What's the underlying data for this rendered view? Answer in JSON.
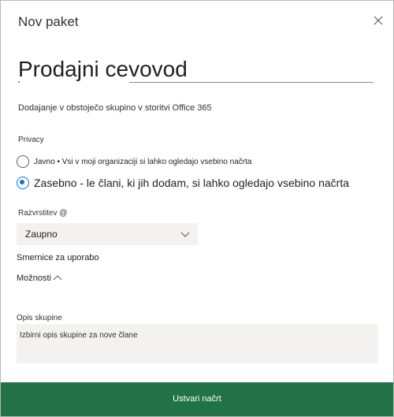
{
  "dialog": {
    "title": "Nov paket",
    "close_icon": "close-icon"
  },
  "name_field": {
    "value": "Prodajni cevovod"
  },
  "subtitle": "Dodajanje v obstoječo skupino v storitvi Office 365",
  "privacy": {
    "label": "Privacy",
    "options": [
      {
        "label": "Javno • Vsi v moji organizaciji si lahko ogledajo vsebino načrta",
        "selected": false
      },
      {
        "label": "Zasebno - le člani, ki jih dodam, si lahko ogledajo vsebino načrta",
        "selected": true
      }
    ]
  },
  "classification": {
    "label": "Razvrstitev @",
    "value": "Zaupno",
    "chevron_icon": "chevron-down-icon"
  },
  "usage_guidelines": "Smernice za uporabo",
  "options_toggle": {
    "label": "Možnosti",
    "chevron_icon": "chevron-up-icon"
  },
  "description": {
    "label": "Opis skupine",
    "placeholder": "Izbirni opis skupine za nove člane"
  },
  "footer": {
    "create_label": "Ustvari načrt"
  },
  "colors": {
    "accent": "#0078d4",
    "footer_bg": "#217346",
    "input_bg": "#f3f2f1"
  }
}
